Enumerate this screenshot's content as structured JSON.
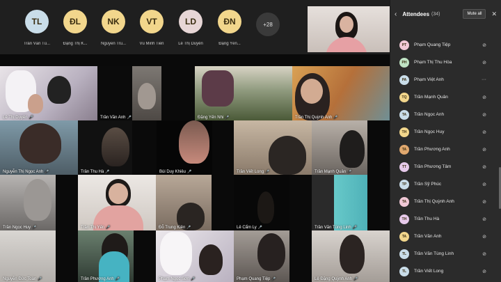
{
  "top_strip": {
    "avatars": [
      {
        "initials": "TL",
        "name": "Trần Văn Tú...",
        "color": "#c9dde9"
      },
      {
        "initials": "ĐL",
        "name": "Đặng Thị K...",
        "color": "#f2d68c"
      },
      {
        "initials": "NK",
        "name": "Nguyễn Tru...",
        "color": "#f2d68c"
      },
      {
        "initials": "VT",
        "name": "Vũ Minh Tiến",
        "color": "#f2d68c"
      },
      {
        "initials": "LD",
        "name": "Lê Thị Duyên",
        "color": "#e7d6d6"
      },
      {
        "initials": "ĐN",
        "name": "Đặng Yến...",
        "color": "#f2d68c"
      }
    ],
    "more_label": "+28"
  },
  "tiles": [
    {
      "name": "Lê Thị Duyên"
    },
    {
      "name": "Trần Văn Anh"
    },
    {
      "name": "Đặng Yến Nhi"
    },
    {
      "name": "Trần Thị Quỳnh Anh"
    },
    {
      "name": "Nguyễn Thị Ngọc Anh"
    },
    {
      "name": "Trần Thu Hà"
    },
    {
      "name": "Bùi Duy Khiêu"
    },
    {
      "name": "Trần Viết Long"
    },
    {
      "name": "Trần Mạnh Quân"
    },
    {
      "name": "Trần Ngọc Huy"
    },
    {
      "name": "Trần Thị Yến"
    },
    {
      "name": "Đỗ Trung Kiên"
    },
    {
      "name": "Lê Cẩm Ly"
    },
    {
      "name": "Trần Văn Tùng Linh"
    },
    {
      "name": "Nguyễn Đức Toàn"
    },
    {
      "name": "Trần Phương Anh"
    },
    {
      "name": "Phạm Ngọc Sơn"
    },
    {
      "name": "Phạm Quang Tiệp"
    },
    {
      "name": "Lê Đặng Quỳnh Anh"
    }
  ],
  "panel": {
    "title": "Attendees",
    "count": "(34)",
    "mute_all": "Mute all",
    "attendees": [
      {
        "initials": "PT",
        "name": "Phạm Quang Tiệp",
        "color": "#f0c8d6",
        "mic": "🎤"
      },
      {
        "initials": "PH",
        "name": "Phạm Thị Thu Hòa",
        "color": "#bfe3c3",
        "mic": "🎤"
      },
      {
        "initials": "PA",
        "name": "Phạm Việt Anh",
        "color": "#c9dde9",
        "mic": "···"
      },
      {
        "initials": "TQ",
        "name": "Trần Mạnh Quân",
        "color": "#f2d68c",
        "mic": "🎤"
      },
      {
        "initials": "TA",
        "name": "Trần Ngọc Anh",
        "color": "#c9dde9",
        "mic": "🎤"
      },
      {
        "initials": "TH",
        "name": "Trần Ngọc Huy",
        "color": "#f2d68c",
        "mic": "🎤"
      },
      {
        "initials": "TA",
        "name": "Trần Phương Anh",
        "color": "#e0a86e",
        "mic": "🎤"
      },
      {
        "initials": "TT",
        "name": "Trần Phương Tâm",
        "color": "#e6c9ea",
        "mic": "🎤"
      },
      {
        "initials": "TP",
        "name": "Trần Sỹ Phúc",
        "color": "#c9dde9",
        "mic": "🎤"
      },
      {
        "initials": "TA",
        "name": "Trần Thị Quỳnh Anh",
        "color": "#f0c8d6",
        "mic": "🎤"
      },
      {
        "initials": "TH",
        "name": "Trần Thu Hà",
        "color": "#e6c9ea",
        "mic": "🎤"
      },
      {
        "initials": "TA",
        "name": "Trần Văn Anh",
        "color": "#f2d68c",
        "mic": "🎤"
      },
      {
        "initials": "TL",
        "name": "Trần Văn Tùng Linh",
        "color": "#c9dde9",
        "mic": "🎤"
      },
      {
        "initials": "TL",
        "name": "Trần Viết Long",
        "color": "#c9dde9",
        "mic": "🎤"
      }
    ]
  }
}
